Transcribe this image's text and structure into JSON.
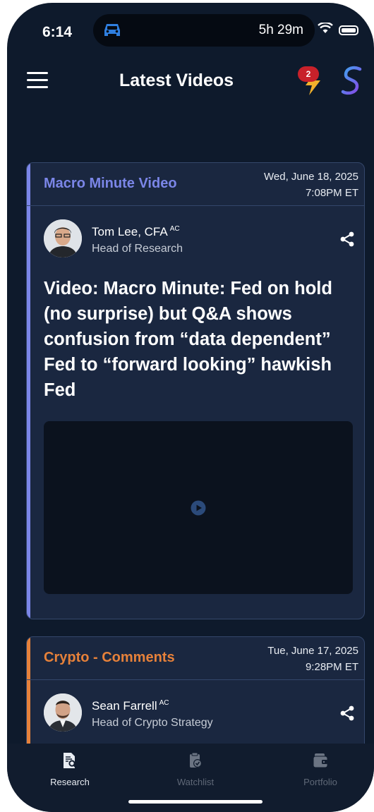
{
  "status_bar": {
    "time": "6:14",
    "timer": "5h 29m"
  },
  "header": {
    "title": "Latest Videos",
    "notification_count": "2"
  },
  "cards": [
    {
      "category": "Macro Minute Video",
      "category_color": "#7b86e8",
      "date_line1": "Wed, June 18, 2025",
      "date_line2": "7:08PM ET",
      "author_name": "Tom Lee, CFA",
      "author_badge": "AC",
      "author_role": "Head of Research",
      "title": "Video: Macro Minute: Fed on hold (no surprise) but Q&A shows confusion from “data dependent” Fed to “forward looking” hawkish Fed"
    },
    {
      "category": "Crypto - Comments",
      "category_color": "#e6813a",
      "date_line1": "Tue, June 17, 2025",
      "date_line2": "9:28PM ET",
      "author_name": "Sean Farrell",
      "author_badge": "AC",
      "author_role": "Head of Crypto Strategy"
    }
  ],
  "tabs": [
    {
      "label": "Research",
      "icon": "research-icon",
      "active": true
    },
    {
      "label": "Watchlist",
      "icon": "watchlist-icon",
      "active": false
    },
    {
      "label": "Portfolio",
      "icon": "portfolio-icon",
      "active": false
    }
  ],
  "colors": {
    "background": "#0e1a2c",
    "card": "#1a2740",
    "accent_blue": "#2f7fe0"
  }
}
